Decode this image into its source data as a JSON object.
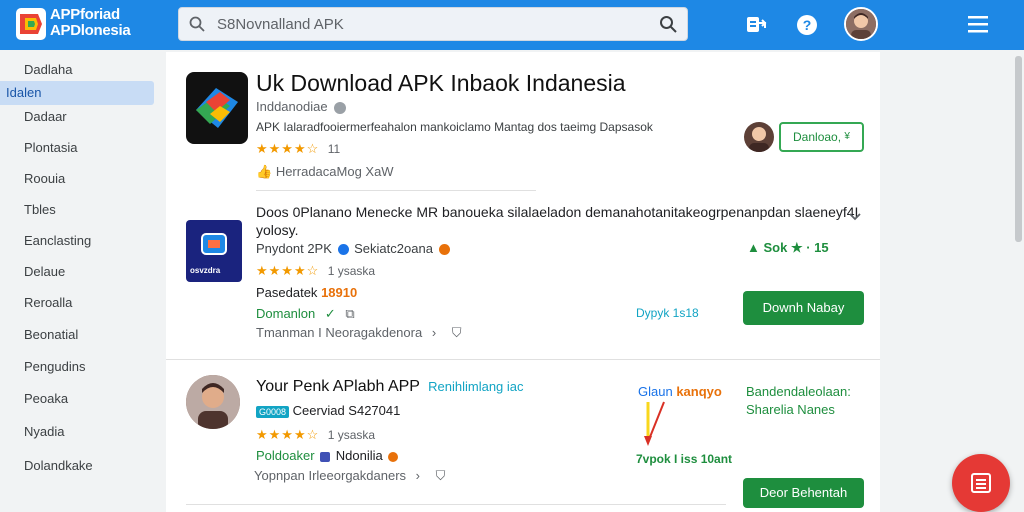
{
  "header": {
    "brand_line1": "APPforiad",
    "brand_line2": "APDlonesia",
    "search_text": "S8Novnalland APK"
  },
  "sidebar": {
    "items": [
      {
        "label": "Dadlaha"
      },
      {
        "label": "Idalen"
      },
      {
        "label": "Dadaar"
      },
      {
        "label": "Plontasia"
      },
      {
        "label": "Roouia"
      },
      {
        "label": "Tbles"
      },
      {
        "label": "Eanclasting"
      },
      {
        "label": "Delaue"
      },
      {
        "label": "Reroalla"
      },
      {
        "label": "Beonatial"
      },
      {
        "label": "Pengudins"
      },
      {
        "label": "Peoaka"
      },
      {
        "label": "Nyadia"
      },
      {
        "label": "Dolandkake"
      }
    ]
  },
  "app": {
    "title": "Uk Download APK Inbaok Indanesia",
    "developer": "Inddanodiae",
    "description": "APK Ialaradfooiermerfeahalon mankoiclamo Mantag dos taeimg  Dapsasok",
    "stars": "★★★★☆",
    "rating_count": "11",
    "meta": "HerradacaMog  XaW",
    "install_label": "Danloao,",
    "install_badge": "¥"
  },
  "cards": [
    {
      "title": "Doos 0Planano Menecke MR banoueka silalaeladon demanahotanitakeogrpenanpdan slaeneyf4I",
      "title2": "yolosy.",
      "subtitle": "Pnydont 2PK",
      "subtitle2": "Sekiatc2oana",
      "stars": "★★★★☆",
      "rating": "1 ysaska",
      "price_label": "Pasedatek",
      "price_value": "18910",
      "platform": "Domanlon",
      "more": "Tmanman I Neoragakdenora",
      "score": "Sok ★ · 15",
      "size": "Dypyk 1s18",
      "button": "Downh Nabay",
      "icon_text": "osvzdra"
    },
    {
      "title": "Your Penk APlabh APP",
      "link": "Renihlimlang iac",
      "badge": "G0008",
      "subtitle": "Ceerviad  S427041",
      "stars": "★★★★☆",
      "rating": "1 ysaska",
      "publisher": "Poldoaker",
      "publisher2": "Ndonilia",
      "more": "Yopnpan Irleeorgakdaners",
      "gain_label": "Glaun",
      "gain_value": "kanqyo",
      "install_line1": "Bandendaleolaan:",
      "install_line2": "Sharelia Nanes",
      "size": "7vpok  I iss 10ant",
      "button": "Deor Behentah"
    }
  ],
  "colors": {
    "topbar": "#1e88e5",
    "accent_green": "#1e8e3e",
    "fab": "#e53935"
  }
}
